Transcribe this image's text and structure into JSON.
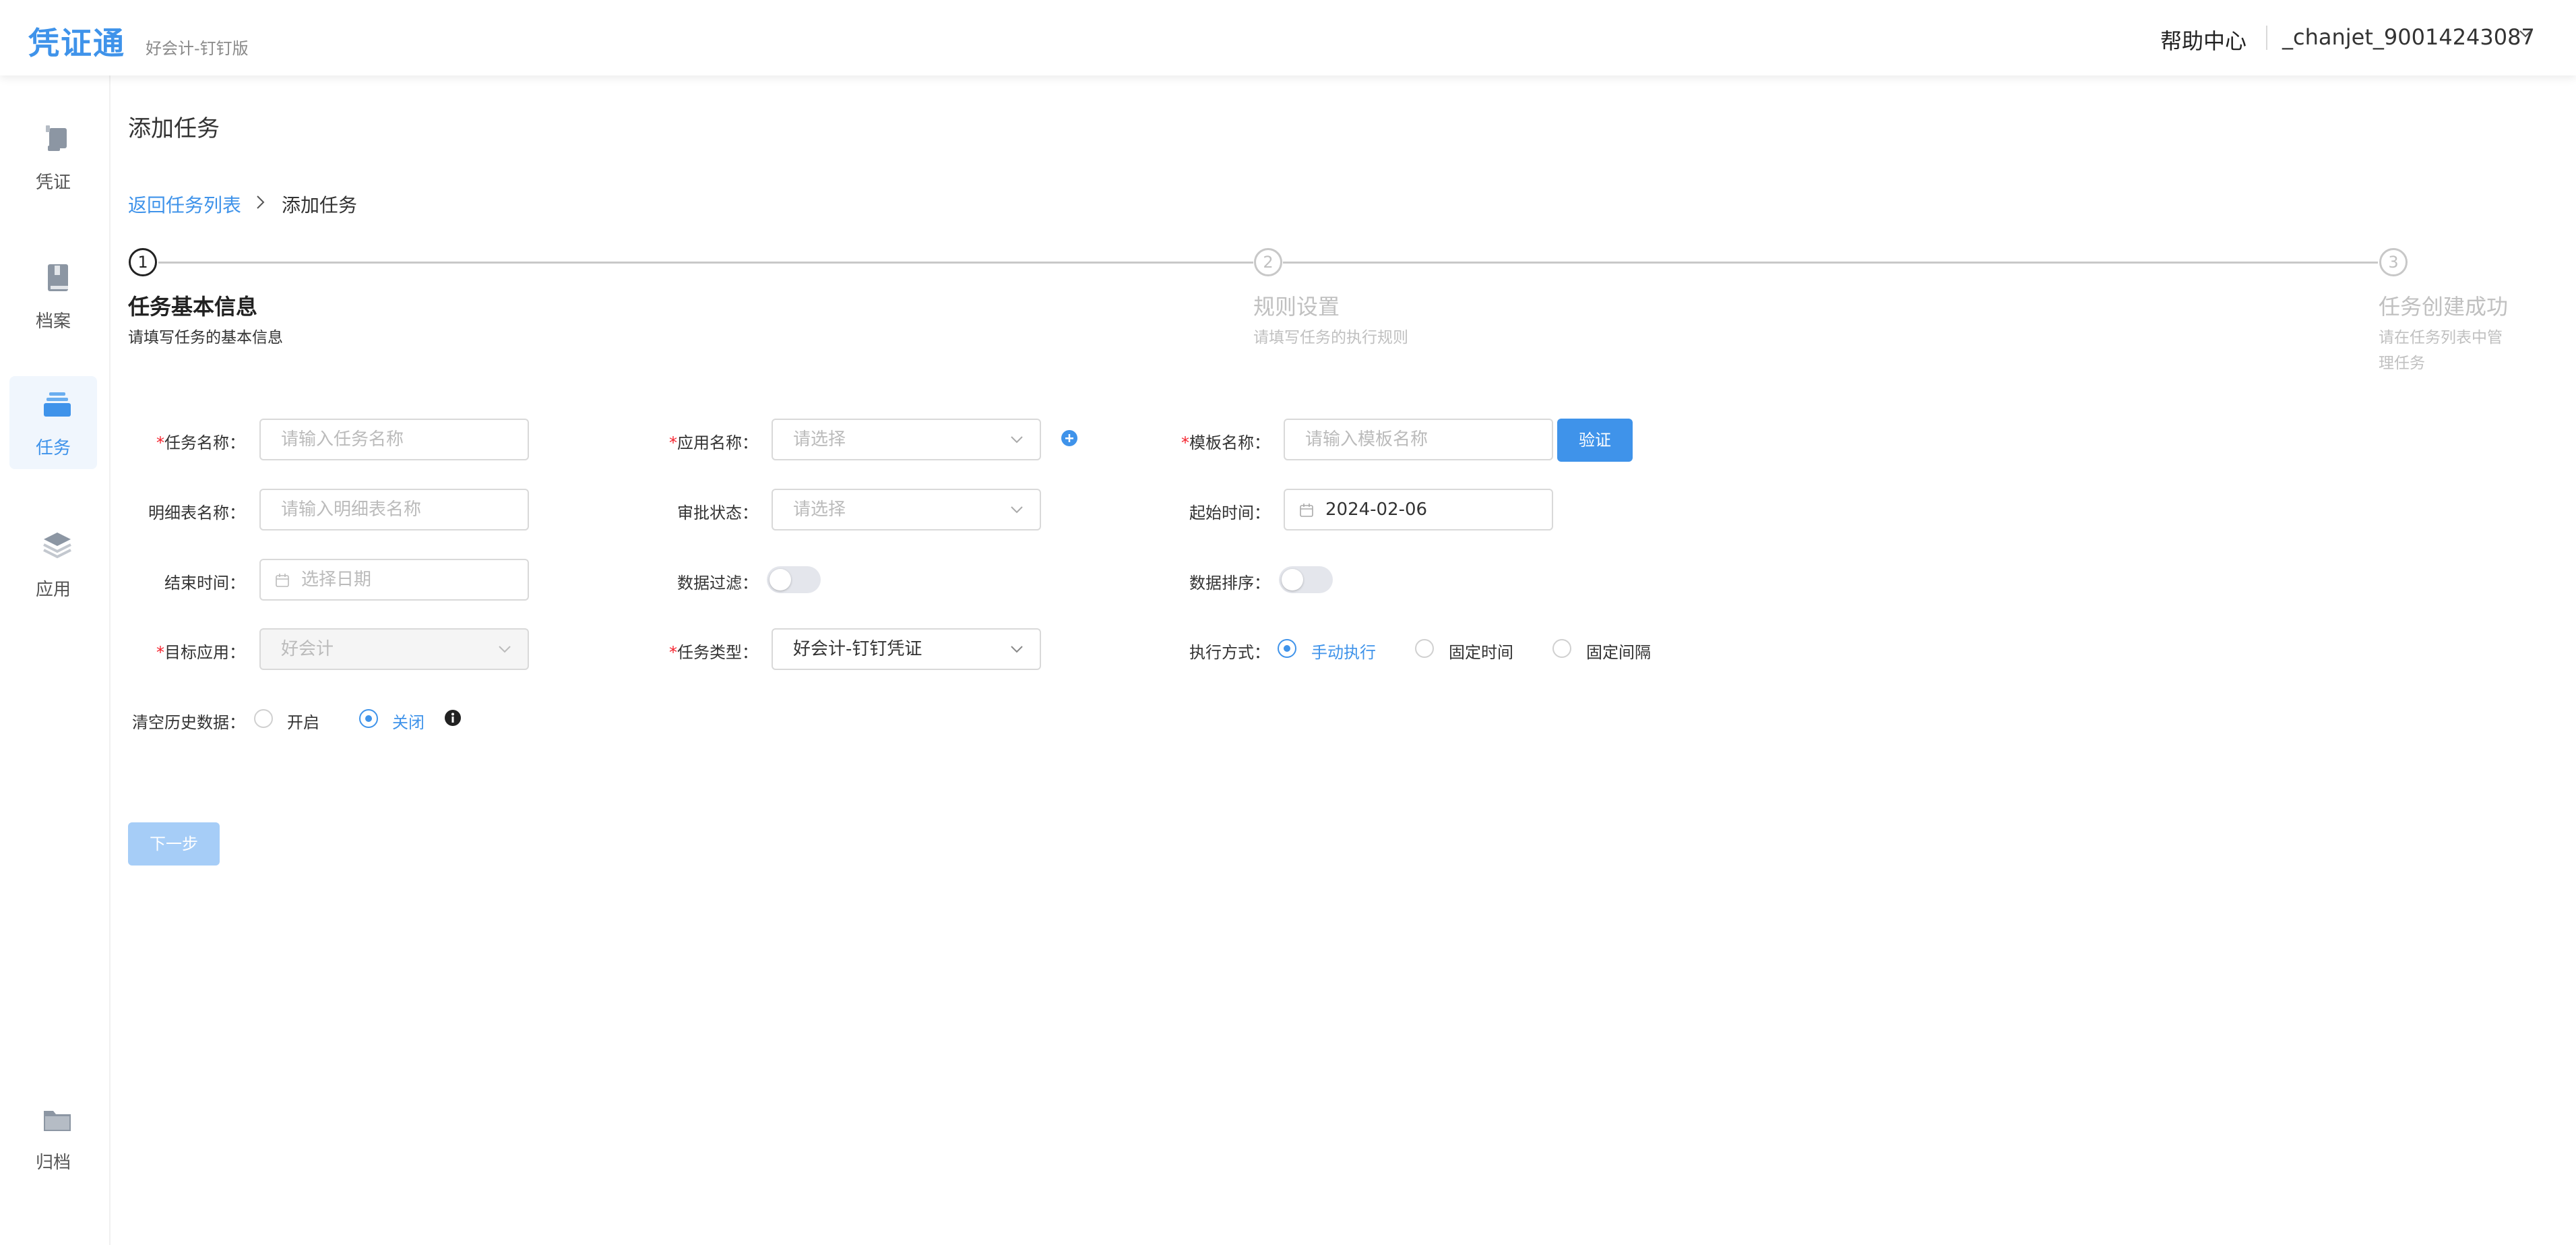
{
  "header": {
    "logo": "凭证通",
    "edition": "好会计-钉钉版",
    "help": "帮助中心",
    "user": "_chanjet_90014243087"
  },
  "sidebar": {
    "items": [
      {
        "label": "凭证",
        "icon": "voucher-icon"
      },
      {
        "label": "档案",
        "icon": "book-icon"
      },
      {
        "label": "任务",
        "icon": "task-icon",
        "active": true
      },
      {
        "label": "应用",
        "icon": "layers-icon"
      },
      {
        "label": "归档",
        "icon": "folder-icon"
      }
    ]
  },
  "page": {
    "title": "添加任务",
    "breadcrumb": {
      "back": "返回任务列表",
      "current": "添加任务"
    }
  },
  "steps": [
    {
      "num": "1",
      "title": "任务基本信息",
      "desc": "请填写任务的基本信息",
      "active": true
    },
    {
      "num": "2",
      "title": "规则设置",
      "desc": "请填写任务的执行规则"
    },
    {
      "num": "3",
      "title": "任务创建成功",
      "desc_lines": [
        "请在任务列表中管",
        "理任务"
      ]
    }
  ],
  "form": {
    "task_name": {
      "label": "任务名称：",
      "placeholder": "请输入任务名称",
      "required": true
    },
    "app_name": {
      "label": "应用名称：",
      "placeholder": "请选择",
      "required": true
    },
    "template_name": {
      "label": "模板名称：",
      "placeholder": "请输入模板名称",
      "required": true,
      "button": "验证"
    },
    "detail_table": {
      "label": "明细表名称：",
      "placeholder": "请输入明细表名称"
    },
    "approval_status": {
      "label": "审批状态：",
      "placeholder": "请选择"
    },
    "start_time": {
      "label": "起始时间：",
      "value": "2024-02-06"
    },
    "end_time": {
      "label": "结束时间：",
      "placeholder": "选择日期"
    },
    "data_filter": {
      "label": "数据过滤：",
      "on": false
    },
    "data_sort": {
      "label": "数据排序：",
      "on": false
    },
    "target_app": {
      "label": "目标应用：",
      "value": "好会计",
      "required": true,
      "disabled": true
    },
    "task_type": {
      "label": "任务类型：",
      "value": "好会计-钉钉凭证",
      "required": true
    },
    "exec_mode": {
      "label": "执行方式：",
      "options": [
        "手动执行",
        "固定时间",
        "固定间隔"
      ],
      "selected": "手动执行"
    },
    "clear_history": {
      "label": "清空历史数据：",
      "options": [
        "开启",
        "关闭"
      ],
      "selected": "关闭"
    }
  },
  "actions": {
    "next": "下一步"
  },
  "colors": {
    "primary": "#3f93ea",
    "required": "#f5222d",
    "disabled_button": "#a6cdf7"
  }
}
